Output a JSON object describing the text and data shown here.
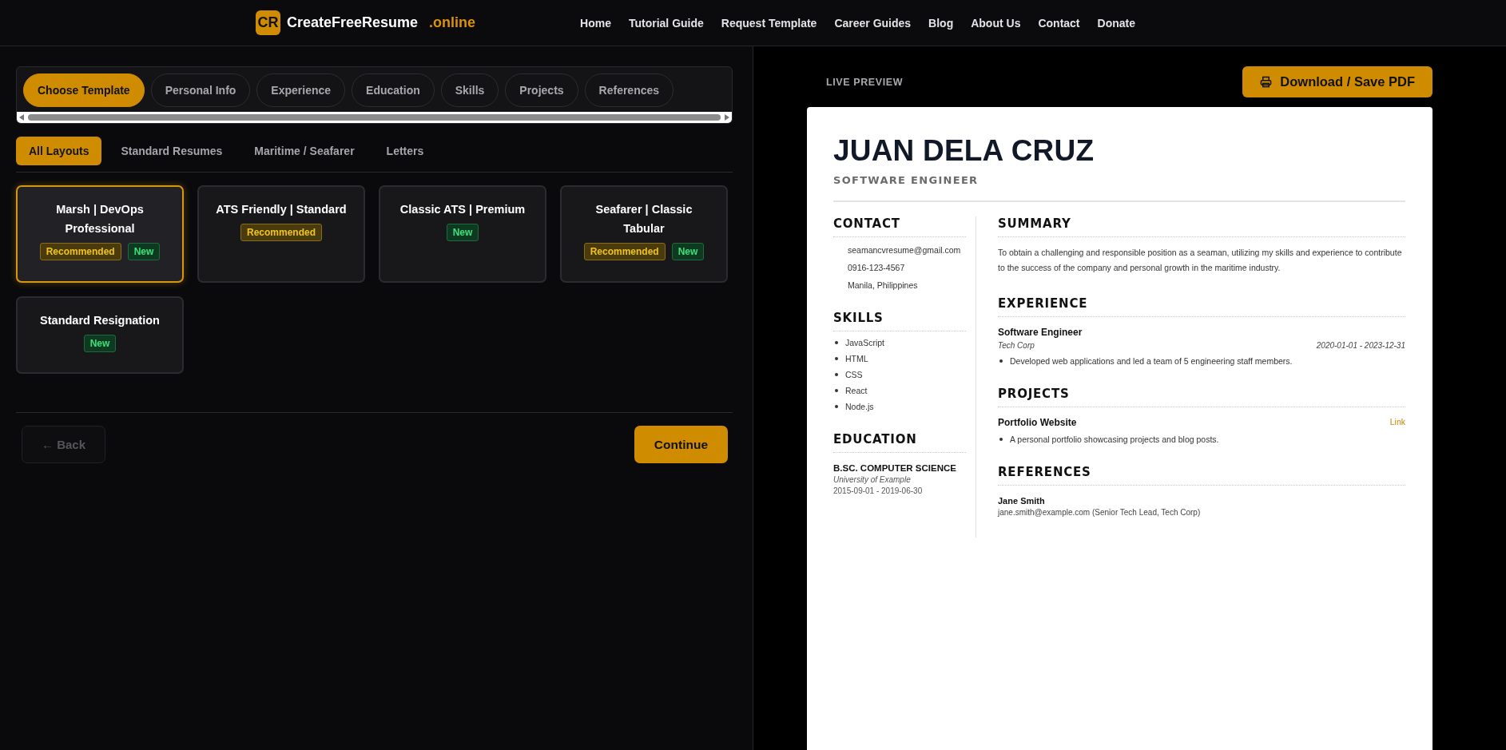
{
  "header": {
    "logo_mark": "CR",
    "logo_text": "CreateFreeResume",
    "logo_suffix": ".online",
    "nav": [
      "Home",
      "Tutorial Guide",
      "Request Template",
      "Career Guides",
      "Blog",
      "About Us",
      "Contact",
      "Donate"
    ]
  },
  "steps": [
    {
      "label": "Choose Template",
      "selected": true
    },
    {
      "label": "Personal Info",
      "selected": false
    },
    {
      "label": "Experience",
      "selected": false
    },
    {
      "label": "Education",
      "selected": false
    },
    {
      "label": "Skills",
      "selected": false
    },
    {
      "label": "Projects",
      "selected": false
    },
    {
      "label": "References",
      "selected": false
    }
  ],
  "filters": [
    {
      "label": "All Layouts",
      "selected": true
    },
    {
      "label": "Standard Resumes",
      "selected": false
    },
    {
      "label": "Maritime / Seafarer",
      "selected": false
    },
    {
      "label": "Letters",
      "selected": false
    }
  ],
  "templates": [
    {
      "name": "Marsh | DevOps Professional",
      "selected": true,
      "badges": [
        {
          "kind": "recommended",
          "label": "Recommended"
        },
        {
          "kind": "new",
          "label": "New"
        }
      ]
    },
    {
      "name": "ATS Friendly | Standard",
      "selected": false,
      "badges": [
        {
          "kind": "recommended",
          "label": "Recommended"
        }
      ]
    },
    {
      "name": "Classic ATS | Premium",
      "selected": false,
      "badges": [
        {
          "kind": "new",
          "label": "New"
        }
      ]
    },
    {
      "name": "Seafarer | Classic Tabular",
      "selected": false,
      "badges": [
        {
          "kind": "recommended",
          "label": "Recommended"
        },
        {
          "kind": "new",
          "label": "New"
        }
      ]
    },
    {
      "name": "Standard Resignation",
      "selected": false,
      "badges": [
        {
          "kind": "new",
          "label": "New"
        }
      ]
    }
  ],
  "back_button": {
    "label": "← Back",
    "disabled": true
  },
  "continue_button": {
    "label": "Continue"
  },
  "preview": {
    "label": "LIVE PREVIEW",
    "download_button": "Download / Save PDF"
  },
  "resume": {
    "name": "JUAN DELA CRUZ",
    "title": "SOFTWARE ENGINEER",
    "contact": {
      "heading": "CONTACT",
      "items": [
        "seamancvresume@gmail.com",
        "0916-123-4567",
        "Manila, Philippines"
      ]
    },
    "skills": {
      "heading": "SKILLS",
      "items": [
        "JavaScript",
        "HTML",
        "CSS",
        "React",
        "Node.js"
      ]
    },
    "education": {
      "heading": "EDUCATION",
      "items": [
        {
          "degree": "B.SC. COMPUTER SCIENCE",
          "school": "University of Example",
          "dates": "2015-09-01 - 2019-06-30"
        }
      ]
    },
    "summary": {
      "heading": "SUMMARY",
      "text": "To obtain a challenging and responsible position as a seaman, utilizing my skills and experience to contribute to the success of the company and personal growth in the maritime industry."
    },
    "experience": {
      "heading": "EXPERIENCE",
      "items": [
        {
          "role": "Software Engineer",
          "company": "Tech Corp",
          "dates": "2020-01-01 - 2023-12-31",
          "bullets": [
            "Developed web applications and led a team of 5 engineering staff members."
          ]
        }
      ]
    },
    "projects": {
      "heading": "PROJECTS",
      "items": [
        {
          "name": "Portfolio Website",
          "link": "Link",
          "bullets": [
            "A personal portfolio showcasing projects and blog posts."
          ]
        }
      ]
    },
    "references": {
      "heading": "REFERENCES",
      "items": [
        {
          "name": "Jane Smith",
          "detail": "jane.smith@example.com (Senior Tech Lead, Tech Corp)"
        }
      ]
    }
  }
}
